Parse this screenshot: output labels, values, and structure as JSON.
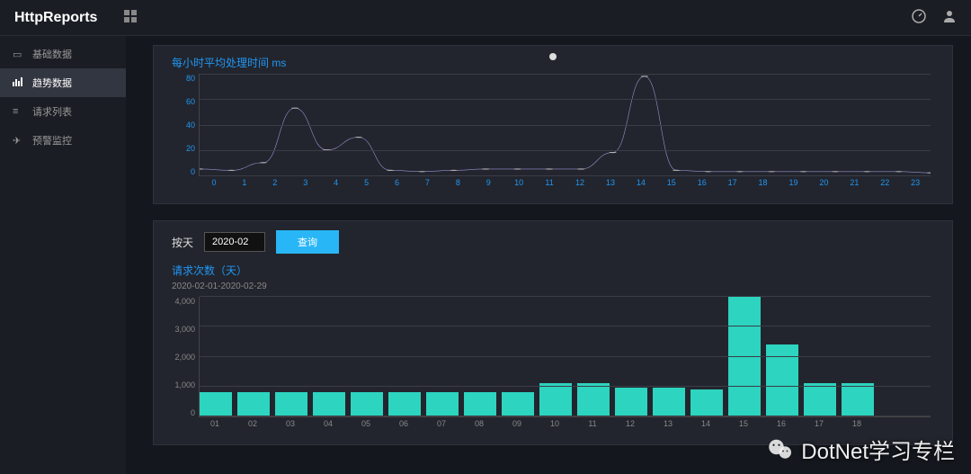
{
  "header": {
    "brand": "HttpReports"
  },
  "sidebar": {
    "items": [
      {
        "icon": "monitor",
        "label": "基础数据"
      },
      {
        "icon": "chart",
        "label": "趋势数据"
      },
      {
        "icon": "list",
        "label": "请求列表"
      },
      {
        "icon": "bell",
        "label": "预警监控"
      }
    ]
  },
  "panel1": {
    "title": "每小时平均处理时间  ms"
  },
  "controls": {
    "by_label": "按天",
    "date_value": "2020-02",
    "query_label": "查询"
  },
  "panel2": {
    "title": "请求次数（天）",
    "subtitle": "2020-02-01-2020-02-29"
  },
  "watermark": "DotNet学习专栏",
  "chart_data": [
    {
      "type": "line",
      "title": "每小时平均处理时间  ms",
      "xlabel": "",
      "ylabel": "",
      "ylim": [
        0,
        80
      ],
      "y_ticks": [
        0,
        20,
        40,
        60,
        80
      ],
      "categories": [
        "0",
        "1",
        "2",
        "3",
        "4",
        "5",
        "6",
        "7",
        "8",
        "9",
        "10",
        "11",
        "12",
        "13",
        "14",
        "15",
        "16",
        "17",
        "18",
        "19",
        "20",
        "21",
        "22",
        "23"
      ],
      "values": [
        5,
        4,
        10,
        53,
        20,
        30,
        4,
        3,
        4,
        5,
        5,
        5,
        5,
        18,
        78,
        4,
        3,
        3,
        3,
        3,
        3,
        3,
        3,
        2
      ]
    },
    {
      "type": "bar",
      "title": "请求次数（天）",
      "subtitle": "2020-02-01-2020-02-29",
      "xlabel": "",
      "ylabel": "",
      "ylim": [
        0,
        4000
      ],
      "y_ticks": [
        0,
        1000,
        2000,
        3000,
        4000
      ],
      "categories": [
        "01",
        "02",
        "03",
        "04",
        "05",
        "06",
        "07",
        "08",
        "09",
        "10",
        "11",
        "12",
        "13",
        "14",
        "15",
        "16",
        "17",
        "18"
      ],
      "values": [
        820,
        820,
        820,
        820,
        820,
        820,
        820,
        820,
        820,
        1100,
        1100,
        950,
        950,
        900,
        4000,
        2400,
        1100,
        1100
      ]
    }
  ]
}
